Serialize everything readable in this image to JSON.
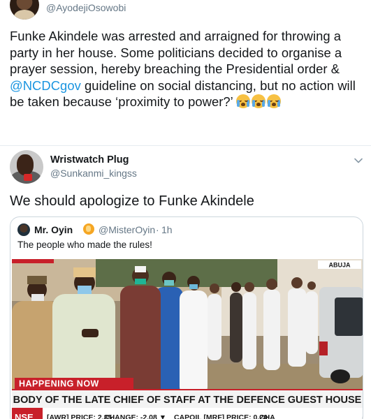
{
  "top_tweet": {
    "handle": "@AyodejiOsowobi",
    "text_before": "Funke Akindele was arrested and arraigned for throwing a party in her house. Some politicians decided to organise a prayer session, hereby breaching the Presidential order & ",
    "mention": "@NCDCgov",
    "text_after": " guideline on social distancing, but no action will be taken because ‘proximity to power?’ ",
    "emoji_name": "loudly-crying-face-icon",
    "emoji_count": 3
  },
  "tweet": {
    "author_name": "Wristwatch Plug",
    "author_handle": "@Sunkanmi_kingss",
    "text": "We should apologize to Funke Akindele"
  },
  "quote": {
    "author_name": "Mr. Oyin",
    "author_handle": "@MisterOyin",
    "separator": "·",
    "time": "1h",
    "text": "The people who made the rules!"
  },
  "media": {
    "location_tag": "ABUJA",
    "happening_label": "HAPPENING NOW",
    "headline": "BODY OF THE LATE CHIEF OF STAFF AT THE DEFENCE GUEST HOUSE",
    "ticker_prefix": "NSE",
    "ticker_items": [
      {
        "name": "[AWR]",
        "label": "PRICE:",
        "value": "2.35"
      },
      {
        "name": "",
        "label": "CHANGE:",
        "value": "-2.08 ▼"
      },
      {
        "name": "CAPOIL [MRF]",
        "label": "PRICE:",
        "value": "0.20"
      },
      {
        "name": "",
        "label": "CHA",
        "value": ""
      }
    ]
  },
  "colors": {
    "link": "#1b95e0",
    "secondary_text": "#657786",
    "border": "#ccd6dd",
    "banner_red": "#c8202a"
  }
}
